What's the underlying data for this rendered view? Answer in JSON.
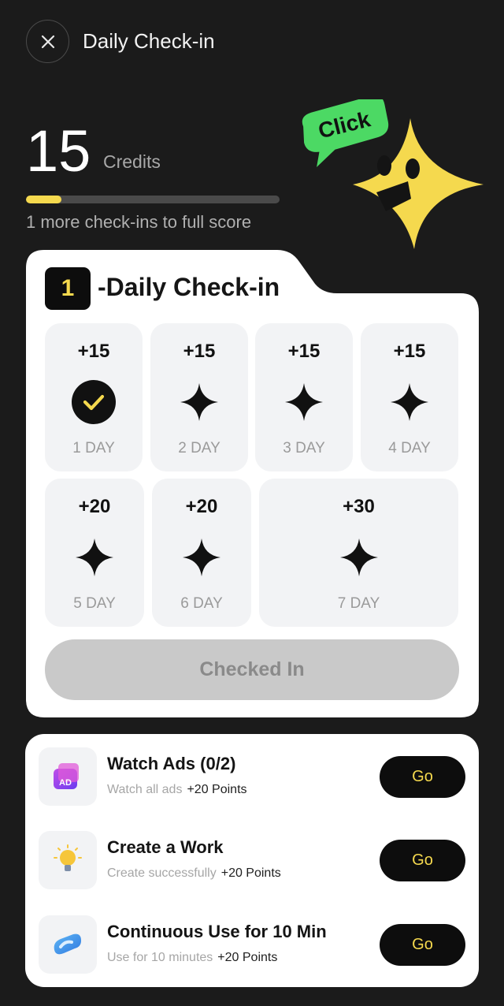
{
  "header": {
    "title": "Daily Check-in",
    "close_icon": "close-icon"
  },
  "credits": {
    "value": "15",
    "label": "Credits",
    "progress_fraction": 0.14,
    "progress_text": "1 more check-ins to full score",
    "accent": "#f5d94e"
  },
  "mascot": {
    "bubble_text": "Click",
    "bubble_color": "#4cd964",
    "star_color": "#f5d94e"
  },
  "checkin": {
    "streak": "1",
    "title": "-Daily Check-in",
    "days": [
      {
        "points": "+15",
        "label": "1 DAY",
        "checked": true
      },
      {
        "points": "+15",
        "label": "2 DAY",
        "checked": false
      },
      {
        "points": "+15",
        "label": "3 DAY",
        "checked": false
      },
      {
        "points": "+15",
        "label": "4 DAY",
        "checked": false
      },
      {
        "points": "+20",
        "label": "5 DAY",
        "checked": false
      },
      {
        "points": "+20",
        "label": "6 DAY",
        "checked": false
      },
      {
        "points": "+30",
        "label": "7 DAY",
        "checked": false
      }
    ],
    "button_label": "Checked In"
  },
  "tasks": [
    {
      "title": "Watch Ads  (0/2)",
      "subtitle": "Watch all ads",
      "points": "+20 Points",
      "button": "Go",
      "icon": "ad-video-icon"
    },
    {
      "title": "Create a Work",
      "subtitle": "Create successfully",
      "points": "+20 Points",
      "button": "Go",
      "icon": "lightbulb-icon"
    },
    {
      "title": "Continuous Use for 10 Min",
      "subtitle": "Use for 10 minutes",
      "points": "+20 Points",
      "button": "Go",
      "icon": "infinity-icon"
    }
  ]
}
